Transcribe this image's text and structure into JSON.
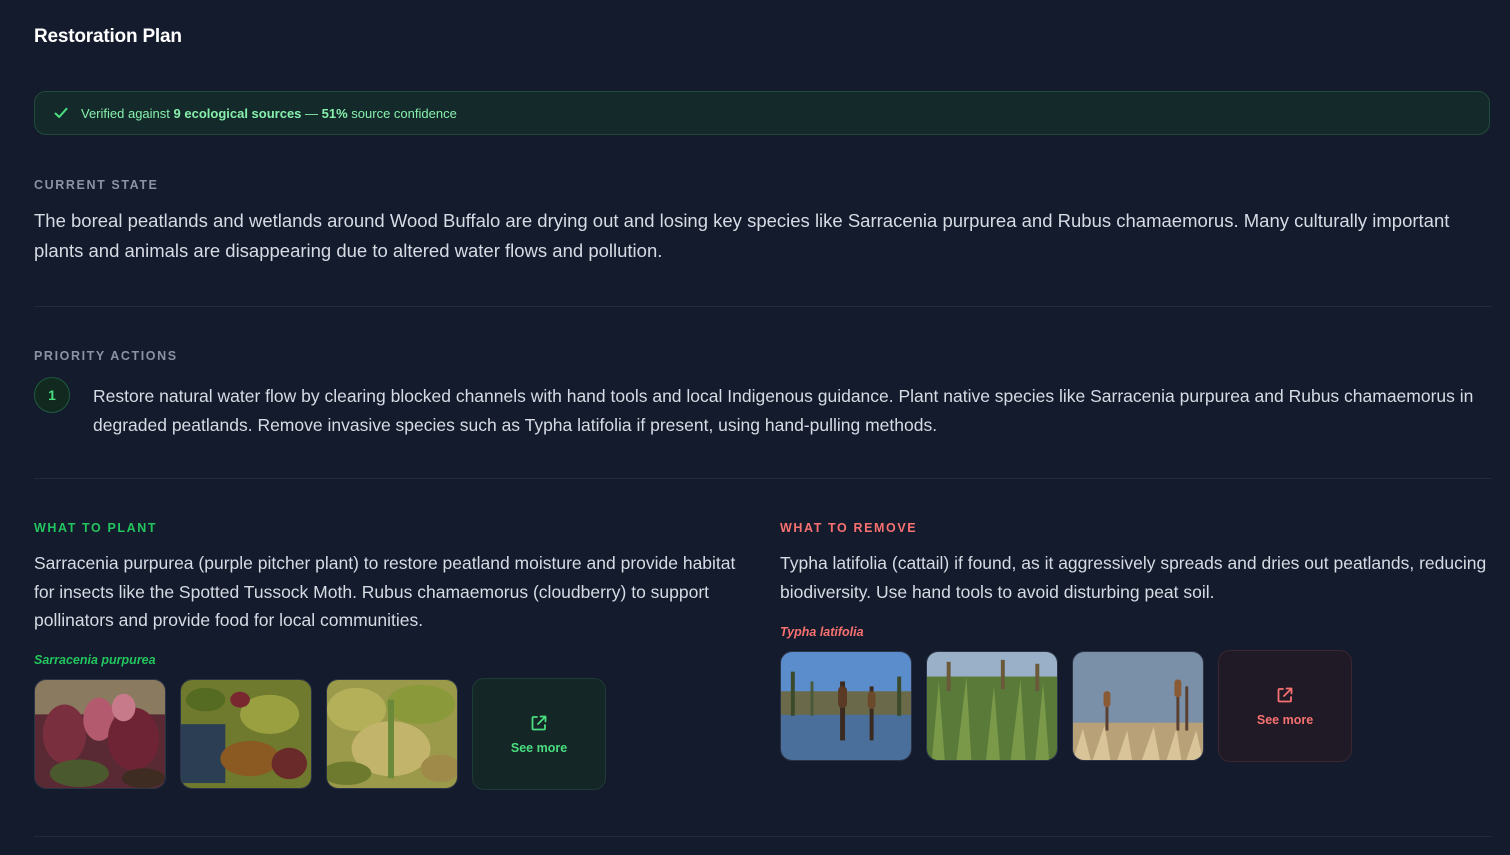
{
  "header": {
    "title": "Restoration Plan"
  },
  "verification": {
    "prefix": "Verified against ",
    "count": "9",
    "sources_label": " ecological sources",
    "separator": " — ",
    "confidence": "51%",
    "confidence_label": " source confidence",
    "icon": "check-icon"
  },
  "current_state": {
    "label": "CURRENT STATE",
    "text": "The boreal peatlands and wetlands around Wood Buffalo are drying out and losing key species like Sarracenia purpurea and Rubus chamaemorus. Many culturally important plants and animals are disappearing due to altered water flows and pollution."
  },
  "priority_actions": {
    "label": "PRIORITY ACTIONS",
    "items": [
      {
        "number": "1",
        "text": "Restore natural water flow by clearing blocked channels with hand tools and local Indigenous guidance. Plant native species like Sarracenia purpurea and Rubus chamaemorus in degraded peatlands. Remove invasive species such as Typha latifolia if present, using hand-pulling methods."
      }
    ]
  },
  "what_to_plant": {
    "label": "WHAT TO PLANT",
    "text": "Sarracenia purpurea (purple pitcher plant) to restore peatland moisture and provide habitat for insects like the Spotted Tussock Moth. Rubus chamaemorus (cloudberry) to support pollinators and provide food for local communities.",
    "species": "Sarracenia purpurea",
    "see_more": "See more",
    "accent": "#22c55e"
  },
  "what_to_remove": {
    "label": "WHAT TO REMOVE",
    "text": "Typha latifolia (cattail) if found, as it aggressively spreads and dries out peatlands, reducing biodiversity. Use hand tools to avoid disturbing peat soil.",
    "species": "Typha latifolia",
    "see_more": "See more",
    "accent": "#f87171"
  },
  "colors": {
    "background": "#141b2c",
    "success": "#4ade80",
    "danger": "#f87171"
  }
}
